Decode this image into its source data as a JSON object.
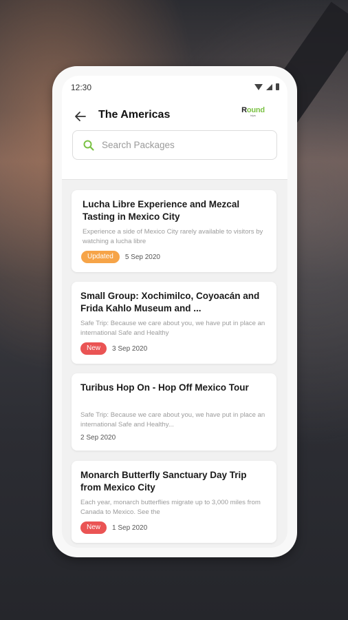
{
  "status_bar": {
    "time": "12:30"
  },
  "header": {
    "title": "The Americas",
    "logo_main_r": "R",
    "logo_main_rest": "ound",
    "logo_sub": "trips"
  },
  "search": {
    "placeholder": "Search Packages",
    "value": ""
  },
  "colors": {
    "accent": "#7ac143",
    "updated_badge": "#f6a448",
    "new_badge": "#ea5454"
  },
  "packages": [
    {
      "title": "Lucha Libre Experience and Mezcal Tasting in Mexico City",
      "description": "Experience a side of Mexico City rarely available to visitors by watching a lucha libre",
      "badge": "Updated",
      "date": "5 Sep 2020"
    },
    {
      "title": "Small Group: Xochimilco, Coyoacán and Frida Kahlo Museum and ...",
      "description": "Safe Trip: Because we care about you, we have put in place an international Safe and Healthy",
      "badge": "New",
      "date": "3 Sep 2020"
    },
    {
      "title": "Turibus Hop On - Hop Off Mexico Tour",
      "description": "Safe Trip: Because we care about you, we have put in place an international Safe and Healthy...",
      "badge": "",
      "date": "2 Sep 2020"
    },
    {
      "title": "Monarch Butterfly Sanctuary Day Trip from Mexico City",
      "description": "Each year, monarch butterflies migrate up to 3,000 miles from Canada to Mexico. See the",
      "badge": "New",
      "date": "1 Sep 2020"
    }
  ]
}
